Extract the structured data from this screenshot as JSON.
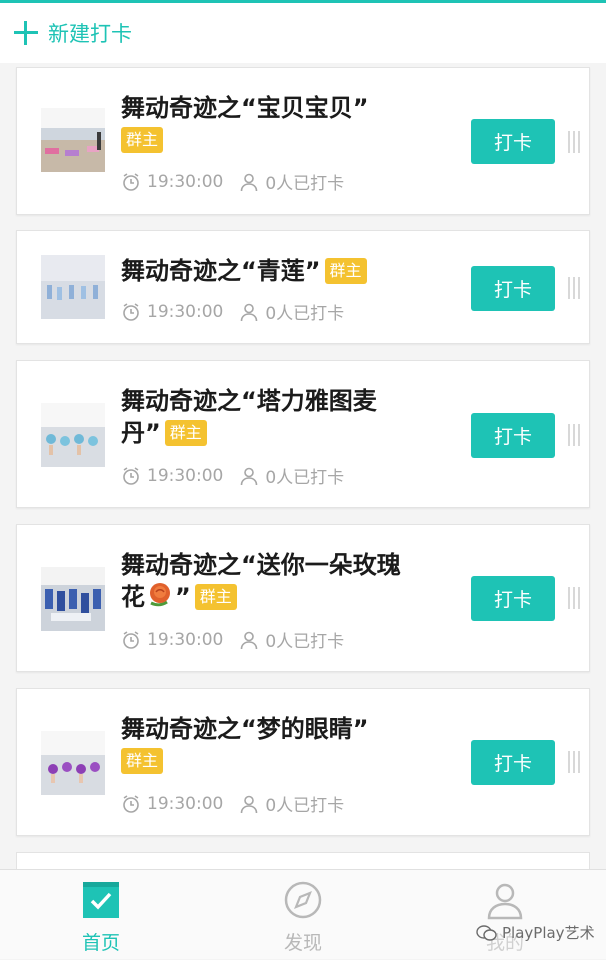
{
  "header": {
    "new_checkin_label": "新建打卡"
  },
  "cards": [
    {
      "title": "舞动奇迹之“宝贝宝贝”",
      "badge": "群主",
      "time": "19:30:00",
      "count": "0人已打卡",
      "button": "打卡"
    },
    {
      "title": "舞动奇迹之“青莲”",
      "badge": "群主",
      "time": "19:30:00",
      "count": "0人已打卡",
      "button": "打卡"
    },
    {
      "title_line1": "舞动奇迹之“塔力雅图麦",
      "title_line2": "丹”",
      "badge": "群主",
      "time": "19:30:00",
      "count": "0人已打卡",
      "button": "打卡"
    },
    {
      "title_line1": "舞动奇迹之“送你一朵玫瑰",
      "title_line2a": "花",
      "title_line2b": "”",
      "badge": "群主",
      "time": "19:30:00",
      "count": "0人已打卡",
      "button": "打卡"
    },
    {
      "title": "舞动奇迹之“梦的眼睛”",
      "badge": "群主",
      "time": "19:30:00",
      "count": "0人已打卡",
      "button": "打卡"
    }
  ],
  "tabs": [
    {
      "label": "首页",
      "active": true
    },
    {
      "label": "发现",
      "active": false
    },
    {
      "label": "我的",
      "active": false
    }
  ],
  "watermark": "PlayPlay艺术",
  "colors": {
    "accent": "#1ec3b5",
    "badge": "#f4c230",
    "muted": "#a6a6a6"
  }
}
